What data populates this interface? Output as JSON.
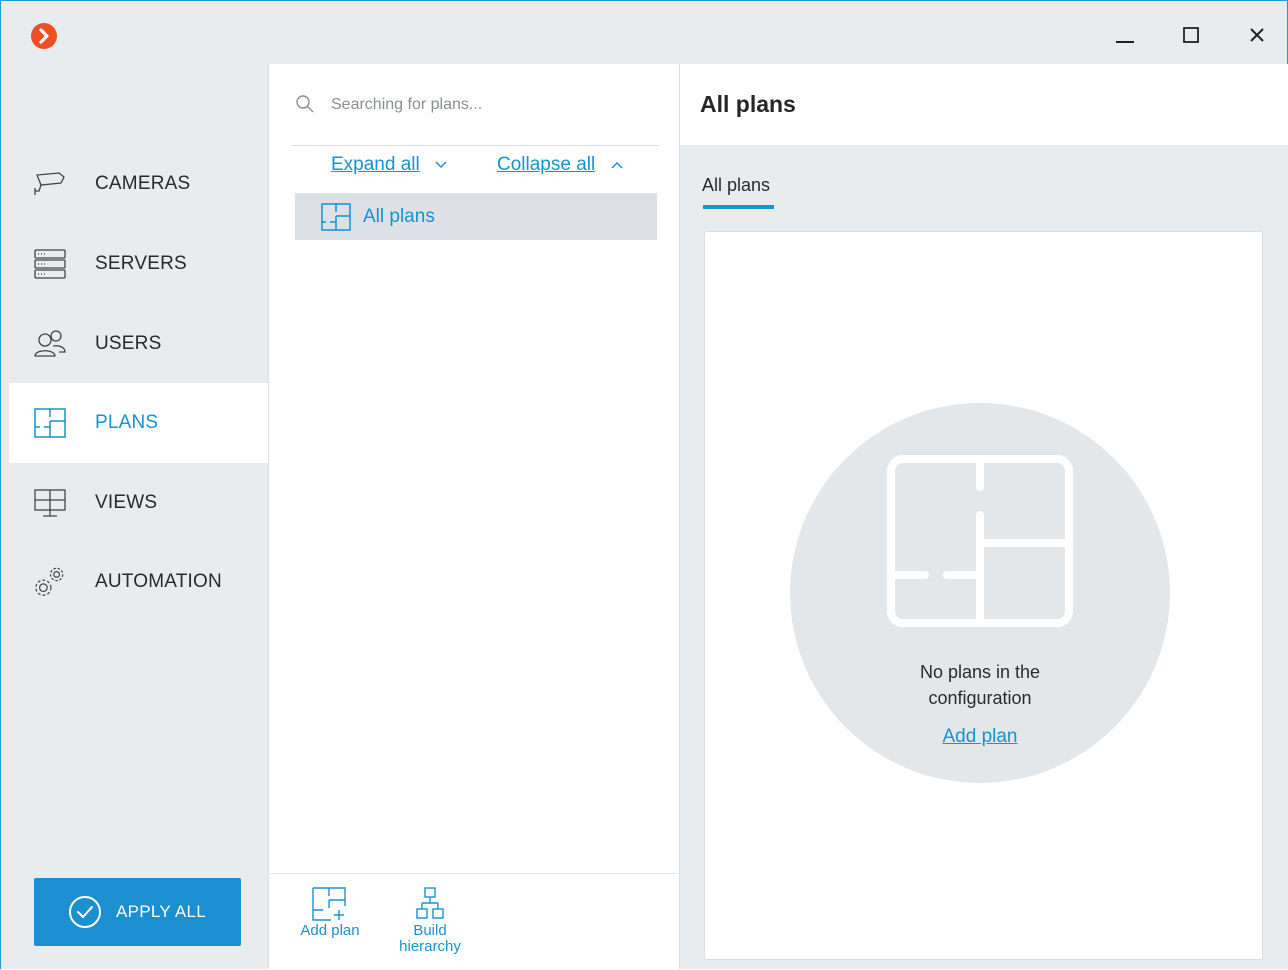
{
  "window": {
    "controls": [
      "minimize-icon",
      "maximize-icon",
      "close-icon"
    ]
  },
  "sidebar": {
    "items": [
      {
        "label": "CAMERAS",
        "icon": "camera-icon"
      },
      {
        "label": "SERVERS",
        "icon": "server-icon"
      },
      {
        "label": "USERS",
        "icon": "users-icon"
      },
      {
        "label": "PLANS",
        "icon": "plan-icon",
        "active": true
      },
      {
        "label": "VIEWS",
        "icon": "views-icon"
      },
      {
        "label": "AUTOMATION",
        "icon": "gears-icon"
      }
    ],
    "apply_label": "APPLY ALL"
  },
  "plans_panel": {
    "search_placeholder": "Searching for plans...",
    "expand_label": "Expand all",
    "collapse_label": "Collapse all",
    "tree": [
      {
        "label": "All plans",
        "selected": true
      }
    ],
    "toolbar": {
      "add_plan_label": "Add plan",
      "build_label_1": "Build",
      "build_label_2": "hierarchy"
    }
  },
  "content": {
    "title": "All plans",
    "tab_label": "All plans",
    "empty_line_1": "No plans in the",
    "empty_line_2": "configuration",
    "empty_action": "Add plan"
  },
  "colors": {
    "accent": "#1593d3",
    "logo": "#ee4f23",
    "sidebar_bg": "#e9ecef",
    "apply_button": "#1b8fd0"
  }
}
